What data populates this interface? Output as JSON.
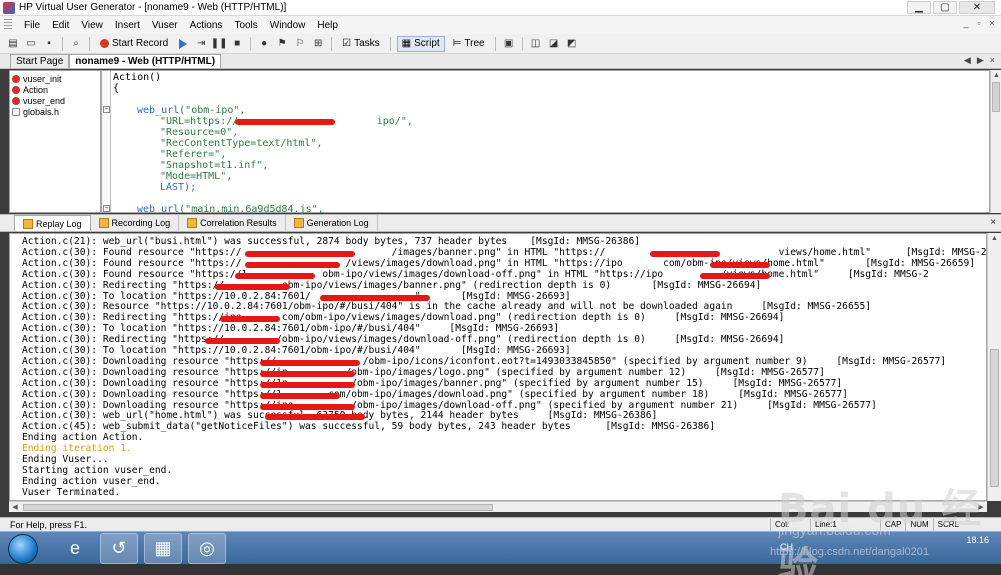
{
  "window": {
    "title": "HP Virtual User Generator - [noname9 - Web (HTTP/HTML)]"
  },
  "menu": [
    "File",
    "Edit",
    "View",
    "Insert",
    "Vuser",
    "Actions",
    "Tools",
    "Window",
    "Help"
  ],
  "toolbar": {
    "start_record": "Start Record",
    "tasks": "Tasks",
    "script": "Script",
    "tree": "Tree"
  },
  "doc_tabs": [
    "Start Page",
    "noname9 - Web (HTTP/HTML)"
  ],
  "tree_items": [
    {
      "label": "vuser_init",
      "icon": "action-icon"
    },
    {
      "label": "Action",
      "icon": "action-icon"
    },
    {
      "label": "vuser_end",
      "icon": "action-icon"
    },
    {
      "label": "globals.h",
      "icon": "file-icon"
    }
  ],
  "code": {
    "l1": "Action()",
    "l2": "{",
    "l3_fn": "web_url",
    "l3_arg": "(\"obm-ipo\",",
    "l4": "\"URL=https://                       ipo/\",",
    "l5": "\"Resource=0\",",
    "l6": "\"RecContentType=text/html\",",
    "l7": "\"Referer=\",",
    "l8": "\"Snapshot=t1.inf\",",
    "l9": "\"Mode=HTML\",",
    "l10": "LAST);",
    "l11_fn": "web_url",
    "l11_arg": "(\"main.min.6a9d5d84.js\","
  },
  "log_tabs": [
    "Replay Log",
    "Recording Log",
    "Correlation Results",
    "Generation Log"
  ],
  "log_lines": [
    "Action.c(21): web_url(\"busi.html\") was successful, 2874 body bytes, 737 header bytes    [MsgId: MMSG-26386]",
    "Action.c(30): Found resource \"https://                          /images/banner.png\" in HTML \"https://                              views/home.html\"      [MsgId: MMSG-26659]",
    "Action.c(30): Found resource \"https://                  /views/images/download.png\" in HTML \"https://ipo       com/obm-ipo/views/home.html\"       [MsgId: MMSG-26659]",
    "Action.c(30): Found resource \"https://1             obm-ipo/views/images/download-off.png\" in HTML \"https://ipo          /views/home.html\"     [MsgId: MMSG-2",
    "Action.c(30): Redirecting \"https://          obm-ipo/views/images/banner.png\" (redirection depth is 0)       [MsgId: MMSG-26694]",
    "Action.c(30): To location \"https://10.0.2.84:7601/                  \"       [MsgId: MMSG-26693]",
    "Action.c(30): Resource \"https://10.0.2.84:7601/obm-ipo/#/busi/404\" is in the cache already and will not be downloaded again     [MsgId: MMSG-26655]",
    "Action.c(30): Redirecting \"https://ipo.      com/obm-ipo/views/images/download.png\" (redirection depth is 0)     [MsgId: MMSG-26694]",
    "Action.c(30): To location \"https://10.0.2.84:7601/obm-ipo/#/busi/404\"     [MsgId: MMSG-26693]",
    "Action.c(30): Redirecting \"https://         /obm-ipo/views/images/download-off.png\" (redirection depth is 0)     [MsgId: MMSG-26694]",
    "Action.c(30): To location \"https://10.0.2.84:7601/obm-ipo/#/busi/404\"       [MsgId: MMSG-26693]",
    "Action.c(30): Downloading resource \"https://               /obm-ipo/icons/iconfont.eot?t=1493033845850\" (specified by argument number 9)     [MsgId: MMSG-26577]",
    "Action.c(30): Downloading resource \"https://ip          /obm-ipo/images/logo.png\" (specified by argument number 12)     [MsgId: MMSG-26577]",
    "Action.c(30): Downloading resource \"https://1p           /obm-ipo/images/banner.png\" (specified by argument number 15)     [MsgId: MMSG-26577]",
    "Action.c(30): Downloading resource \"https://1        com/obm-ipo/images/download.png\" (specified by argument number 18)     [MsgId: MMSG-26577]",
    "Action.c(30): Downloading resource \"https://ipo          /obm-ipo/images/download-off.png\" (specified by argument number 21)     [MsgId: MMSG-26577]",
    "Action.c(30): web_url(\"home.html\") was successful, 63750 body bytes, 2144 header bytes     [MsgId: MMSG-26386]",
    "Action.c(45): web_submit_data(\"getNoticeFiles\") was successful, 59 body bytes, 243 header bytes      [MsgId: MMSG-26386]",
    "Ending action Action.",
    "Ending iteration 1.",
    "Ending Vuser...",
    "Starting action vuser_end.",
    "Ending action vuser_end.",
    "Vuser Terminated."
  ],
  "info_line_index": 19,
  "status": {
    "help": "For Help, press F1.",
    "col": "Col:",
    "line": "Line:1",
    "caps": "CAP",
    "num": "NUM",
    "scrl": "SCRL"
  },
  "tray": {
    "time": "18:16",
    "lang": "CH"
  },
  "watermark": {
    "brand": "Bai du 经验",
    "sub": "jingyan.baidu.com",
    "url": "https://blog.csdn.net/dangal0201"
  },
  "colors": {
    "accent_red": "#e51717",
    "code_keyword": "#2e6bd6",
    "code_string": "#2c7d3b",
    "info_text": "#e59b12"
  }
}
